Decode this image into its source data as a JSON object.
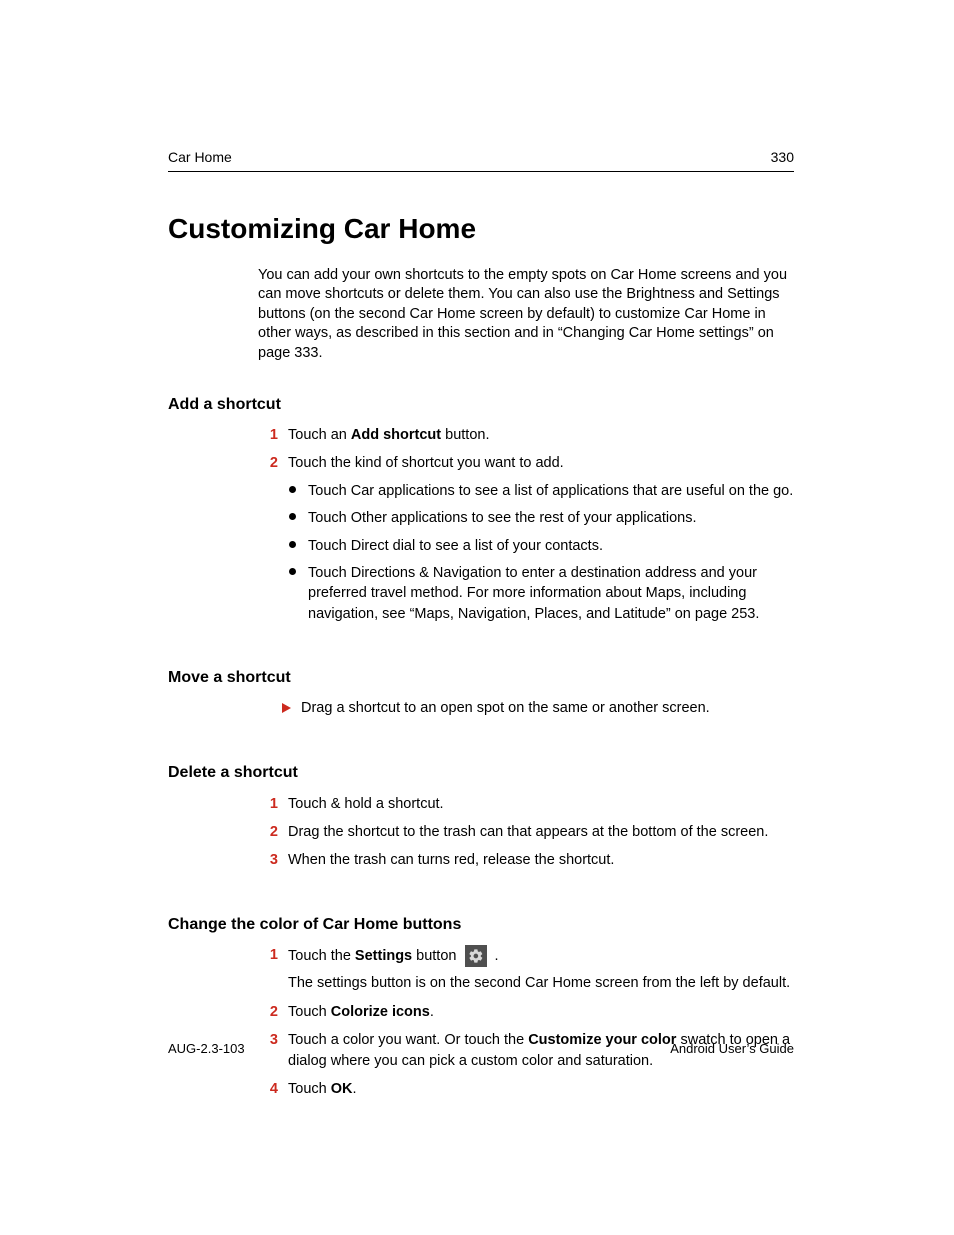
{
  "header": {
    "section": "Car Home",
    "page_number": "330"
  },
  "title": "Customizing Car Home",
  "intro": "You can add your own shortcuts to the empty spots on Car Home screens and you can move shortcuts or delete them. You can also use the Brightness and Settings buttons (on the second Car Home screen by default) to customize Car Home in other ways, as described in this section and in “Changing Car Home settings” on page 333.",
  "sections": {
    "add": {
      "heading": "Add a shortcut",
      "step1_num": "1",
      "step1_pre": "Touch an ",
      "step1_bold": "Add shortcut",
      "step1_post": " button.",
      "step2_num": "2",
      "step2_text": "Touch the kind of shortcut you want to add.",
      "b1_pre": "Touch ",
      "b1_bold": "Car applications",
      "b1_post": " to see a list of applications that are useful on the go.",
      "b2_pre": "Touch ",
      "b2_bold": "Other applications",
      "b2_post": " to see the rest of your applications.",
      "b3_pre": "Touch ",
      "b3_bold": "Direct dial",
      "b3_post": " to see a list of your contacts.",
      "b4_pre": "Touch ",
      "b4_bold": "Directions & Navigation",
      "b4_post": " to enter a destination address and your preferred travel method. For more information about Maps, including navigation, see “Maps, Navigation, Places, and Latitude” on page 253."
    },
    "move": {
      "heading": "Move a shortcut",
      "line": "Drag a shortcut to an open spot on the same or another screen."
    },
    "delete": {
      "heading": "Delete a shortcut",
      "s1_num": "1",
      "s1_text": "Touch & hold a shortcut.",
      "s2_num": "2",
      "s2_text": "Drag the shortcut to the trash can that appears at the bottom of the screen.",
      "s3_num": "3",
      "s3_text": "When the trash can turns red, release the shortcut."
    },
    "color": {
      "heading": "Change the color of Car Home buttons",
      "s1_num": "1",
      "s1_pre": "Touch the ",
      "s1_bold": "Settings",
      "s1_mid": " button ",
      "s1_post": " .",
      "s1_sub": "The settings button is on the second Car Home screen from the left by default.",
      "s2_num": "2",
      "s2_pre": "Touch ",
      "s2_bold": "Colorize icons",
      "s2_post": ".",
      "s3_num": "3",
      "s3_pre": "Touch a color you want. Or touch the ",
      "s3_bold": "Customize your color",
      "s3_post": " swatch to open a dialog where you can pick a custom color and saturation.",
      "s4_num": "4",
      "s4_pre": "Touch ",
      "s4_bold": "OK",
      "s4_post": "."
    }
  },
  "footer": {
    "left": "AUG-2.3-103",
    "right": "Android User’s Guide"
  }
}
